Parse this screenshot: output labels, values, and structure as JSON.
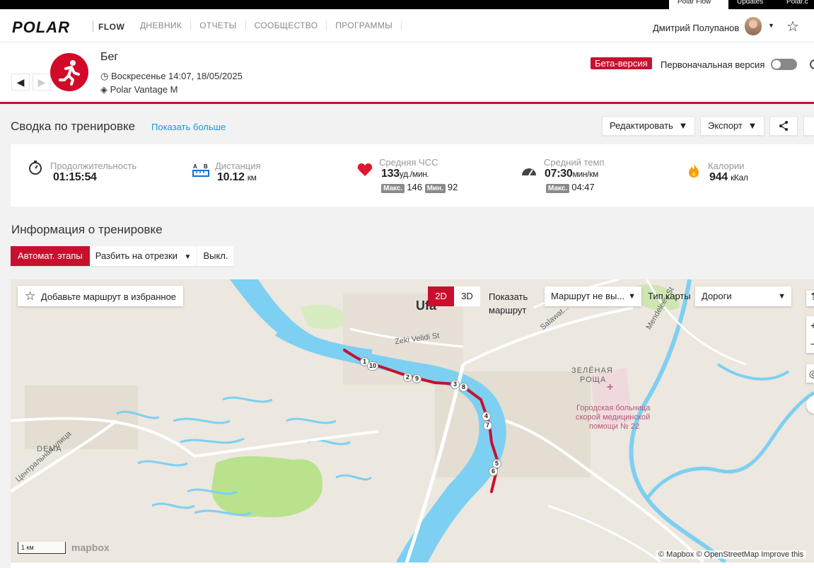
{
  "top_tabs": [
    "Polar Flow",
    "Updates",
    "Polar.c"
  ],
  "header": {
    "logo": "POLAR",
    "product": "FLOW",
    "nav": [
      "ДНЕВНИК",
      "ОТЧЕТЫ",
      "СООБЩЕСТВО",
      "ПРОГРАММЫ"
    ],
    "user_name": "Дмитрий Полупанов"
  },
  "activity": {
    "prev_icon": "◀",
    "next_icon": "▶",
    "sport": "Бег",
    "date": "Воскресенье 14:07, 18/05/2025",
    "device": "Polar Vantage M",
    "beta": "Бета-версия",
    "original_version": "Первоначальная версия"
  },
  "summary": {
    "title": "Сводка по тренировке",
    "show_more": "Показать больше",
    "edit": "Редактировать",
    "export": "Экспорт"
  },
  "stats": {
    "duration": {
      "label": "Продолжительность",
      "value": "01:15:54"
    },
    "distance": {
      "label": "Дистанция",
      "value": "10.12",
      "unit": "км"
    },
    "hr": {
      "label": "Средняя ЧСС",
      "value": "133",
      "unit": "уд./мин.",
      "max_tag": "Макс.",
      "max": "146",
      "min_tag": "Мин.",
      "min": "92"
    },
    "pace": {
      "label": "Средний темп",
      "value": "07:30",
      "unit": "мин/км",
      "max_tag": "Макс.",
      "max": "04:47"
    },
    "calories": {
      "label": "Калории",
      "value": "944",
      "unit": "кКал"
    }
  },
  "info": {
    "title": "Информация о тренировке",
    "auto_laps": "Автомат. этапы",
    "split": "Разбить на отрезки",
    "off": "Выкл."
  },
  "map": {
    "add_favorite": "Добавьте маршрут в избранное",
    "btn_2d": "2D",
    "btn_3d": "3D",
    "show_route_line1": "Показать",
    "show_route_line2": "маршрут",
    "route_select": "Маршрут не вы...",
    "map_type_label": "Тип карты",
    "map_type_value": "Дороги",
    "scale": "1 км",
    "mapbox": "mapbox",
    "attribution": "© Mapbox © OpenStreetMap  Improve this",
    "labels": {
      "city": "Ufa",
      "street1": "Zeki Velidi St",
      "street2": "Salawat...",
      "street3": "Mendeleev St",
      "district1": "ЗЕЛЁНАЯ",
      "district2": "РОЩА",
      "hospital1": "Городская больница",
      "hospital2": "скорой медицинской",
      "hospital3": "помощи № 22",
      "dema": "DEMA",
      "central_street": "Центральная улица"
    },
    "laps": [
      "1",
      "10",
      "2",
      "9",
      "3",
      "8",
      "4",
      "7",
      "5",
      "6"
    ]
  },
  "colors": {
    "brand_red": "#c8102e",
    "link_blue": "#1a9ad6",
    "water": "#7dd0f2",
    "park": "#b9e28c"
  }
}
